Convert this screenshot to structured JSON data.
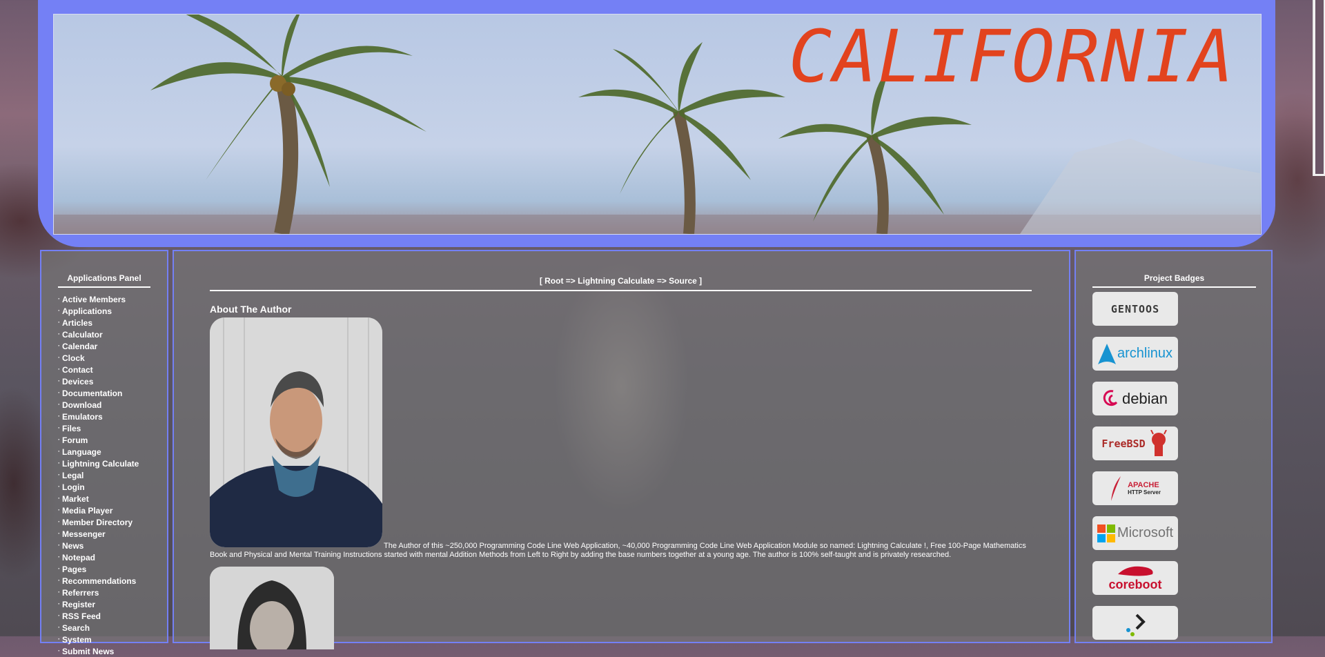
{
  "banner": {
    "title": "CALIFORNIA"
  },
  "sidebar": {
    "heading": "Applications Panel",
    "items": [
      {
        "label": "Active Members"
      },
      {
        "label": "Applications"
      },
      {
        "label": "Articles"
      },
      {
        "label": "Calculator"
      },
      {
        "label": "Calendar"
      },
      {
        "label": "Clock"
      },
      {
        "label": "Contact"
      },
      {
        "label": "Devices"
      },
      {
        "label": "Documentation"
      },
      {
        "label": "Download"
      },
      {
        "label": "Emulators"
      },
      {
        "label": "Files"
      },
      {
        "label": "Forum"
      },
      {
        "label": "Language"
      },
      {
        "label": "Lightning Calculate"
      },
      {
        "label": "Legal"
      },
      {
        "label": "Login"
      },
      {
        "label": "Market"
      },
      {
        "label": "Media Player"
      },
      {
        "label": "Member Directory"
      },
      {
        "label": "Messenger"
      },
      {
        "label": "News"
      },
      {
        "label": "Notepad"
      },
      {
        "label": "Pages"
      },
      {
        "label": "Recommendations"
      },
      {
        "label": "Referrers"
      },
      {
        "label": "Register"
      },
      {
        "label": "RSS Feed"
      },
      {
        "label": "Search"
      },
      {
        "label": "System"
      },
      {
        "label": "Submit News"
      }
    ]
  },
  "main": {
    "breadcrumb": "[ Root => Lightning Calculate => Source ]",
    "about_heading": "About The Author",
    "author_text": "The Author of this ~250,000 Programming Code Line Web Application, ~40,000 Programming Code Line Web Application Module so named: Lightning Calculate !, Free 100-Page Mathematics Book and Physical and Mental Training Instructions started with mental Addition Methods from Left to Right by adding the base numbers together at a young age. The author is 100% self-taught and is privately researched."
  },
  "badges": {
    "heading": "Project Badges",
    "items": [
      {
        "label": "GENTOOS",
        "color": "#3a3a3a"
      },
      {
        "label": "archlinux",
        "color": "#1793d1"
      },
      {
        "label": "debian",
        "color": "#222222"
      },
      {
        "label": "FreeBSD",
        "color": "#ab2b28"
      },
      {
        "label": "APACHE",
        "sub": "HTTP Server",
        "color": "#c92037"
      },
      {
        "label": "Microsoft",
        "color": "#737373"
      },
      {
        "label": "coreboot",
        "color": "#c8102e"
      },
      {
        "label": "",
        "color": "#222222"
      }
    ]
  },
  "colors": {
    "frame": "#7480f5",
    "title": "#e2431e"
  }
}
